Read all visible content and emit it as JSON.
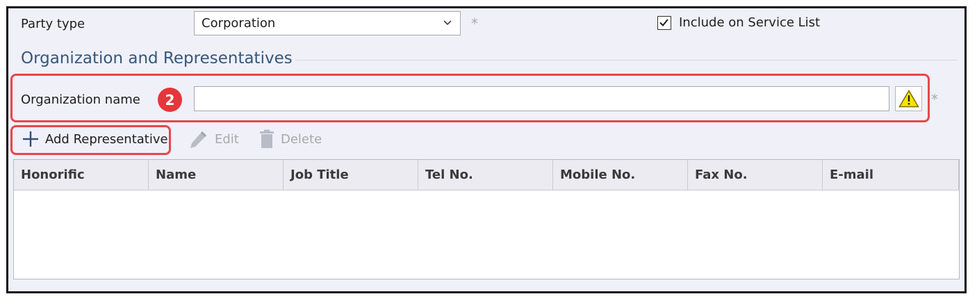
{
  "party": {
    "label": "Party type",
    "selected": "Corporation",
    "required_mark": "*"
  },
  "service_list": {
    "label": "Include on Service List",
    "checked": true
  },
  "section": {
    "title": "Organization and Representatives"
  },
  "organization": {
    "label": "Organization name",
    "value": "",
    "step_badge": "2",
    "required_mark": "*"
  },
  "toolbar": {
    "add_label": "Add Representative",
    "edit_label": "Edit",
    "delete_label": "Delete"
  },
  "table": {
    "columns": [
      "Honorific",
      "Name",
      "Job Title",
      "Tel No.",
      "Mobile No.",
      "Fax No.",
      "E-mail"
    ],
    "rows": []
  },
  "colors": {
    "highlight": "#e8464c",
    "section_title": "#34587b",
    "badge": "#e3373b",
    "warning": "#f5e400",
    "background": "#f0f0f9"
  },
  "icons": {
    "chevron": "chevron-down-icon",
    "check": "checkmark-icon",
    "warning": "warning-triangle-icon",
    "add": "plus-icon",
    "edit": "pencil-icon",
    "delete": "trash-icon"
  }
}
